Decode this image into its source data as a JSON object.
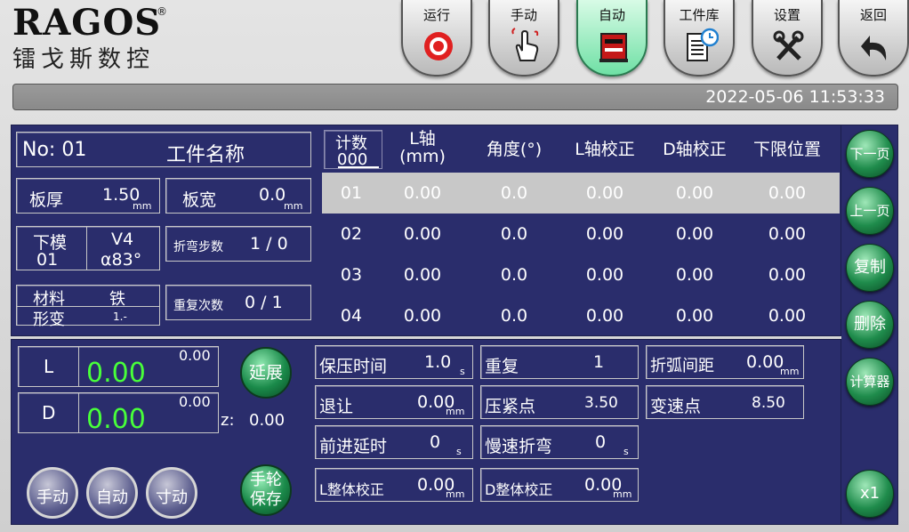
{
  "header": {
    "logo": "RAGOS",
    "reg": "®",
    "brand": "镭戈斯数控",
    "tabs": [
      {
        "label": "运行",
        "icon": "record-icon"
      },
      {
        "label": "手动",
        "icon": "hand-icon"
      },
      {
        "label": "自动",
        "icon": "machine-icon"
      },
      {
        "label": "工件库",
        "icon": "document-icon"
      },
      {
        "label": "设置",
        "icon": "tools-icon"
      },
      {
        "label": "返回",
        "icon": "back-arrow-icon"
      }
    ],
    "active_tab": "自动",
    "datetime": "2022-05-06 11:53:33"
  },
  "workpiece": {
    "no": "No: 01",
    "name_label": "工件名称",
    "thickness_label": "板厚",
    "thickness": "1.50",
    "thickness_unit": "mm",
    "width_label": "板宽",
    "width": "0.0",
    "width_unit": "mm",
    "die_label": "下模",
    "die_no": "01",
    "die_name": "V4",
    "die_angle": "α83°",
    "steps_label": "折弯步数",
    "steps": "1 / 0",
    "material_label": "材料",
    "material": "铁",
    "deform_label": "形变",
    "deform": "1.-",
    "repeat_label": "重复次数",
    "repeat": "0 / 1"
  },
  "table": {
    "count_label": "计数",
    "count": "000",
    "columns": [
      "L轴\n(mm)",
      "角度(°)",
      "L轴校正",
      "D轴校正",
      "下限位置"
    ],
    "rows": [
      {
        "id": "01",
        "values": [
          "0.00",
          "0.0",
          "0.00",
          "0.00",
          "0.00"
        ]
      },
      {
        "id": "02",
        "values": [
          "0.00",
          "0.0",
          "0.00",
          "0.00",
          "0.00"
        ]
      },
      {
        "id": "03",
        "values": [
          "0.00",
          "0.0",
          "0.00",
          "0.00",
          "0.00"
        ]
      },
      {
        "id": "04",
        "values": [
          "0.00",
          "0.0",
          "0.00",
          "0.00",
          "0.00"
        ]
      }
    ],
    "selected_row": "01"
  },
  "side_buttons": [
    "下一页",
    "上一页",
    "复制",
    "删除",
    "计算器"
  ],
  "x1": "x1",
  "axes": {
    "l_label": "L",
    "l_small": "0.00",
    "l_value": "0.00",
    "d_label": "D",
    "d_small": "0.00",
    "d_value": "0.00",
    "z_label": "z:",
    "z_value": "0.00",
    "extend": "延展",
    "handwheel": "手轮\n保存",
    "modes": [
      "手动",
      "自动",
      "寸动"
    ]
  },
  "params": {
    "hold_label": "保压时间",
    "hold": "1.0",
    "hold_unit": "s",
    "retreat_label": "退让",
    "retreat": "0.00",
    "retreat_unit": "mm",
    "delay_label": "前进延时",
    "delay": "0",
    "delay_unit": "s",
    "lcorr_label": "L整体校正",
    "lcorr": "0.00",
    "lcorr_unit": "mm",
    "repeat_label": "重复",
    "repeat": "1",
    "clamp_label": "压紧点",
    "clamp": "3.50",
    "slow_label": "慢速折弯",
    "slow": "0",
    "slow_unit": "s",
    "dcorr_label": "D整体校正",
    "dcorr": "0.00",
    "dcorr_unit": "mm",
    "arc_label": "折弧间距",
    "arc": "0.00",
    "arc_unit": "mm",
    "speed_label": "变速点",
    "speed": "8.50"
  }
}
